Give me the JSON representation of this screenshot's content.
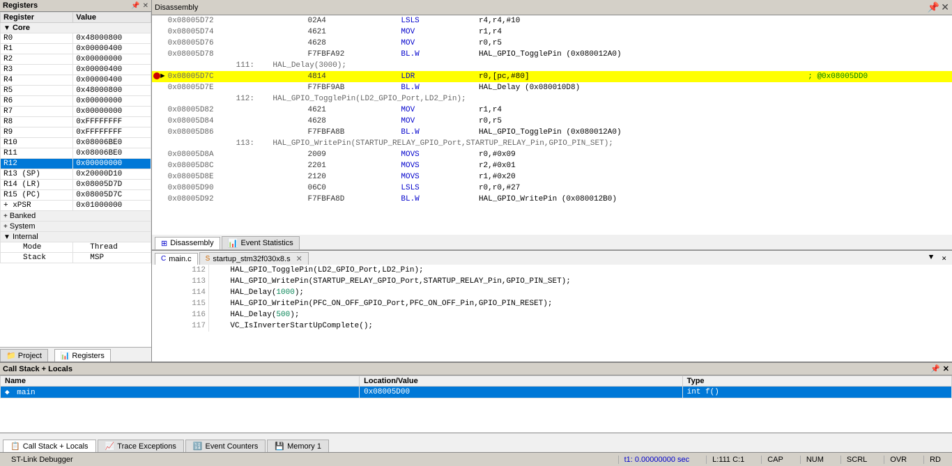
{
  "registers": {
    "title": "Registers",
    "columns": [
      "Register",
      "Value"
    ],
    "core_label": "Core",
    "registers": [
      {
        "name": "R0",
        "value": "0x48000800",
        "selected": false
      },
      {
        "name": "R1",
        "value": "0x00000400",
        "selected": false
      },
      {
        "name": "R2",
        "value": "0x00000000",
        "selected": false
      },
      {
        "name": "R3",
        "value": "0x00000400",
        "selected": false
      },
      {
        "name": "R4",
        "value": "0x00000400",
        "selected": false
      },
      {
        "name": "R5",
        "value": "0x48000800",
        "selected": false
      },
      {
        "name": "R6",
        "value": "0x00000000",
        "selected": false
      },
      {
        "name": "R7",
        "value": "0x00000000",
        "selected": false
      },
      {
        "name": "R8",
        "value": "0xFFFFFFFF",
        "selected": false
      },
      {
        "name": "R9",
        "value": "0xFFFFFFFF",
        "selected": false
      },
      {
        "name": "R10",
        "value": "0x08006BE0",
        "selected": false
      },
      {
        "name": "R11",
        "value": "0x08006BE0",
        "selected": false
      },
      {
        "name": "R12",
        "value": "0x00000000",
        "selected": true
      },
      {
        "name": "R13 (SP)",
        "value": "0x20000D10",
        "selected": false
      },
      {
        "name": "R14 (LR)",
        "value": "0x08005D7D",
        "selected": false
      },
      {
        "name": "R15 (PC)",
        "value": "0x08005D7C",
        "selected": false
      }
    ],
    "xpsr": {
      "name": "xPSR",
      "value": "0x01000000"
    },
    "banked_label": "Banked",
    "system_label": "System",
    "internal_label": "Internal",
    "mode_label": "Mode",
    "mode_value": "Thread",
    "stack_label": "Stack",
    "stack_value": "MSP",
    "tabs": [
      "Project",
      "Registers"
    ]
  },
  "disassembly": {
    "title": "Disassembly",
    "rows": [
      {
        "arrow": "",
        "address": "0x08005D72",
        "opcode": "02A4",
        "mnemonic": "LSLS",
        "operands": "r4,r4,#10",
        "comment": ""
      },
      {
        "arrow": "",
        "address": "0x08005D74",
        "opcode": "4621",
        "mnemonic": "MOV",
        "operands": "r1,r4",
        "comment": ""
      },
      {
        "arrow": "",
        "address": "0x08005D76",
        "opcode": "4628",
        "mnemonic": "MOV",
        "operands": "r0,r5",
        "comment": ""
      },
      {
        "arrow": "",
        "address": "0x08005D78",
        "opcode": "F7FBFA92",
        "mnemonic": "BL.W",
        "operands": "HAL_GPIO_TogglePin (0x080012A0)",
        "comment": ""
      },
      {
        "arrow": "",
        "address": "",
        "opcode": "",
        "mnemonic": "",
        "operands": "111:    HAL_Delay(3000);",
        "comment": "",
        "is_comment": true
      },
      {
        "arrow": "►",
        "address": "0x08005D7C",
        "opcode": "4814",
        "mnemonic": "LDR",
        "operands": "r0,[pc,#80]",
        "comment": "; @0x08005DD0",
        "current": true,
        "breakpoint": true
      },
      {
        "arrow": "",
        "address": "0x08005D7E",
        "opcode": "F7FBF9AB",
        "mnemonic": "BL.W",
        "operands": "HAL_Delay (0x080010D8)",
        "comment": ""
      },
      {
        "arrow": "",
        "address": "",
        "opcode": "",
        "mnemonic": "",
        "operands": "112:    HAL_GPIO_TogglePin(LD2_GPIO_Port,LD2_Pin);",
        "comment": "",
        "is_comment": true
      },
      {
        "arrow": "",
        "address": "0x08005D82",
        "opcode": "4621",
        "mnemonic": "MOV",
        "operands": "r1,r4",
        "comment": ""
      },
      {
        "arrow": "",
        "address": "0x08005D84",
        "opcode": "4628",
        "mnemonic": "MOV",
        "operands": "r0,r5",
        "comment": ""
      },
      {
        "arrow": "",
        "address": "0x08005D86",
        "opcode": "F7FBFA8B",
        "mnemonic": "BL.W",
        "operands": "HAL_GPIO_TogglePin (0x080012A0)",
        "comment": ""
      },
      {
        "arrow": "",
        "address": "",
        "opcode": "",
        "mnemonic": "",
        "operands": "113:    HAL_GPIO_WritePin(STARTUP_RELAY_GPIO_Port,STARTUP_RELAY_Pin,GPIO_PIN_SET);",
        "comment": "",
        "is_comment": true
      },
      {
        "arrow": "",
        "address": "0x08005D8A",
        "opcode": "2009",
        "mnemonic": "MOVS",
        "operands": "r0,#0x09",
        "comment": ""
      },
      {
        "arrow": "",
        "address": "0x08005D8C",
        "opcode": "2201",
        "mnemonic": "MOVS",
        "operands": "r2,#0x01",
        "comment": ""
      },
      {
        "arrow": "",
        "address": "0x08005D8E",
        "opcode": "2120",
        "mnemonic": "MOVS",
        "operands": "r1,#0x20",
        "comment": ""
      },
      {
        "arrow": "",
        "address": "0x08005D90",
        "opcode": "06C0",
        "mnemonic": "LSLS",
        "operands": "r0,r0,#27",
        "comment": ""
      },
      {
        "arrow": "",
        "address": "0x08005D92",
        "opcode": "F7FBFA8D",
        "mnemonic": "BL.W",
        "operands": "HAL_GPIO_WritePin (0x080012B0)",
        "comment": ""
      }
    ],
    "tabs": [
      {
        "label": "Disassembly",
        "icon": "disassembly-icon",
        "active": true
      },
      {
        "label": "Event Statistics",
        "icon": "chart-icon",
        "active": false
      }
    ]
  },
  "source": {
    "tabs": [
      {
        "label": "main.c",
        "icon": "c-file-icon",
        "active": true,
        "closable": false
      },
      {
        "label": "startup_stm32f030x8.s",
        "icon": "s-file-icon",
        "active": false,
        "closable": true
      }
    ],
    "lines": [
      {
        "num": "112",
        "code": "    HAL_GPIO_TogglePin(LD2_GPIO_Port,LD2_Pin);"
      },
      {
        "num": "113",
        "code": "    HAL_GPIO_WritePin(STARTUP_RELAY_GPIO_Port,STARTUP_RELAY_Pin,GPIO_PIN_SET);"
      },
      {
        "num": "114",
        "code": "    HAL_Delay(1000);"
      },
      {
        "num": "115",
        "code": "    HAL_GPIO_WritePin(PFC_ON_OFF_GPIO_Port,PFC_ON_OFF_Pin,GPIO_PIN_RESET);"
      },
      {
        "num": "116",
        "code": "    HAL_Delay(500);"
      },
      {
        "num": "117",
        "code": "    VC_IsInverterStartUpComplete();"
      }
    ],
    "scrollbar_items": []
  },
  "callstack": {
    "title": "Call Stack + Locals",
    "columns": [
      "Name",
      "Location/Value",
      "Type"
    ],
    "rows": [
      {
        "name": "main",
        "location": "0x08005D00",
        "type": "int f()",
        "selected": true
      }
    ]
  },
  "bottom_tabs": [
    {
      "label": "Call Stack + Locals",
      "icon": "callstack-icon",
      "active": true
    },
    {
      "label": "Trace Exceptions",
      "icon": "trace-icon",
      "active": false
    },
    {
      "label": "Event Counters",
      "icon": "event-icon",
      "active": false
    },
    {
      "label": "Memory 1",
      "icon": "memory-icon",
      "active": false
    }
  ],
  "status_bar": {
    "debugger": "ST-Link Debugger",
    "time": "t1: 0.00000000 sec",
    "location": "L:111 C:1",
    "caps": "CAP",
    "num": "NUM",
    "scrl": "SCRL",
    "ovr": "OVR",
    "read": "RD"
  }
}
